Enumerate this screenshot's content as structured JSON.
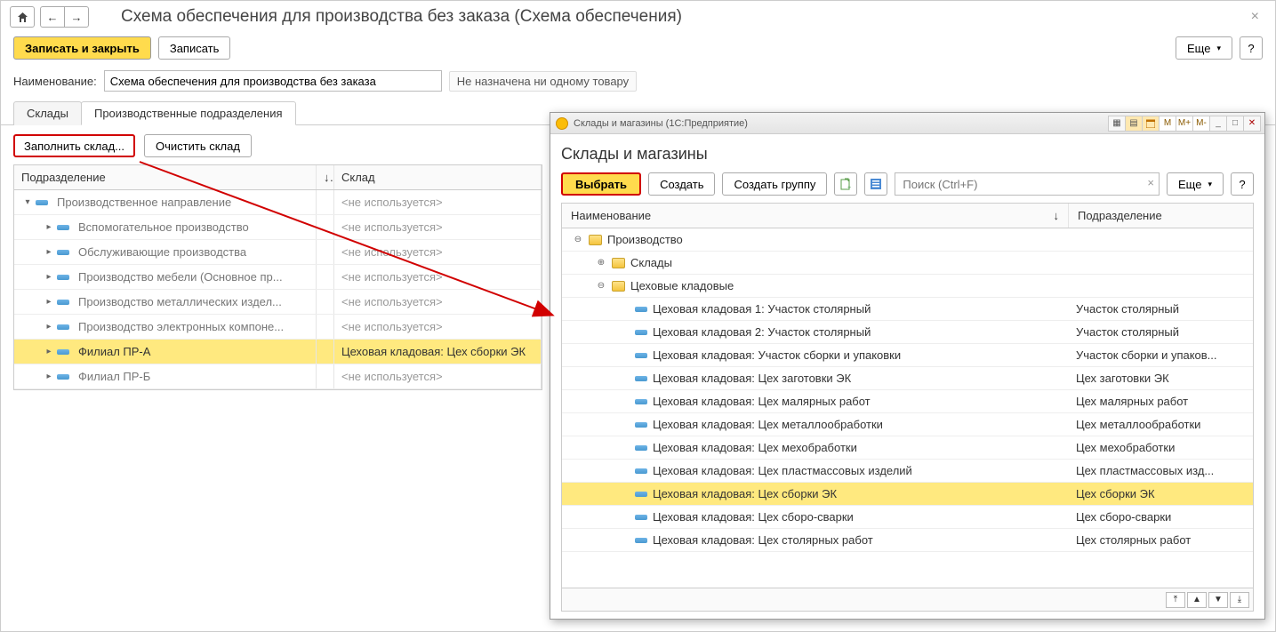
{
  "main": {
    "title": "Схема обеспечения для производства без заказа (Схема обеспечения)",
    "save_close": "Записать и закрыть",
    "save": "Записать",
    "more": "Еще",
    "help": "?",
    "name_label": "Наименование:",
    "name_value": "Схема обеспечения для производства без заказа",
    "unassigned_text": "Не назначена ни одному товару",
    "tabs": {
      "warehouses": "Склады",
      "prod_units": "Производственные подразделения"
    },
    "fill_warehouse": "Заполнить склад...",
    "clear_warehouse": "Очистить склад",
    "grid_head": {
      "dept": "Подразделение",
      "sort": "↓",
      "sklad": "Склад"
    },
    "rows": [
      {
        "indent": 0,
        "toggle": "▾",
        "label": "Производственное направление",
        "sklad": "<не используется>",
        "sel": false
      },
      {
        "indent": 1,
        "toggle": "▸",
        "label": "Вспомогательное производство",
        "sklad": "<не используется>",
        "sel": false
      },
      {
        "indent": 1,
        "toggle": "▸",
        "label": "Обслуживающие производства",
        "sklad": "<не используется>",
        "sel": false
      },
      {
        "indent": 1,
        "toggle": "▸",
        "label": "Производство мебели (Основное пр...",
        "sklad": "<не используется>",
        "sel": false
      },
      {
        "indent": 1,
        "toggle": "▸",
        "label": "Производство металлических издел...",
        "sklad": "<не используется>",
        "sel": false
      },
      {
        "indent": 1,
        "toggle": "▸",
        "label": "Производство электронных компоне...",
        "sklad": "<не используется>",
        "sel": false
      },
      {
        "indent": 1,
        "toggle": "▸",
        "label": "Филиал ПР-А",
        "sklad": "Цеховая кладовая: Цех сборки ЭК",
        "sel": true
      },
      {
        "indent": 1,
        "toggle": "▸",
        "label": "Филиал ПР-Б",
        "sklad": "<не используется>",
        "sel": false
      }
    ]
  },
  "popup": {
    "win_caption": "Склады и магазины  (1С:Предприятие)",
    "win_tools": {
      "m": "M",
      "mplus": "M+",
      "mminus": "M-"
    },
    "title": "Склады и магазины",
    "select": "Выбрать",
    "create": "Создать",
    "create_group": "Создать группу",
    "search_placeholder": "Поиск (Ctrl+F)",
    "more": "Еще",
    "help": "?",
    "head_name": "Наименование",
    "head_sort": "↓",
    "head_dept": "Подразделение",
    "rows": [
      {
        "type": "folder",
        "indent": 0,
        "toggle": "⊖",
        "label": "Производство",
        "dept": ""
      },
      {
        "type": "folder",
        "indent": 1,
        "toggle": "⊕",
        "label": "Склады",
        "dept": ""
      },
      {
        "type": "folder",
        "indent": 1,
        "toggle": "⊖",
        "label": "Цеховые кладовые",
        "dept": ""
      },
      {
        "type": "leaf",
        "indent": 2,
        "label": "Цеховая кладовая 1: Участок столярный",
        "dept": "Участок столярный"
      },
      {
        "type": "leaf",
        "indent": 2,
        "label": "Цеховая кладовая 2: Участок столярный",
        "dept": "Участок столярный"
      },
      {
        "type": "leaf",
        "indent": 2,
        "label": "Цеховая кладовая: Участок сборки и упаковки",
        "dept": "Участок сборки и упаков..."
      },
      {
        "type": "leaf",
        "indent": 2,
        "label": "Цеховая кладовая: Цех заготовки ЭК",
        "dept": "Цех заготовки ЭК"
      },
      {
        "type": "leaf",
        "indent": 2,
        "label": "Цеховая кладовая: Цех малярных работ",
        "dept": "Цех малярных работ"
      },
      {
        "type": "leaf",
        "indent": 2,
        "label": "Цеховая кладовая: Цех металлообработки",
        "dept": "Цех металлообработки"
      },
      {
        "type": "leaf",
        "indent": 2,
        "label": "Цеховая кладовая: Цех мехобработки",
        "dept": "Цех мехобработки"
      },
      {
        "type": "leaf",
        "indent": 2,
        "label": "Цеховая кладовая: Цех пластмассовых изделий",
        "dept": "Цех пластмассовых изд..."
      },
      {
        "type": "leaf",
        "indent": 2,
        "label": "Цеховая кладовая: Цех сборки ЭК",
        "dept": "Цех сборки ЭК",
        "sel": true
      },
      {
        "type": "leaf",
        "indent": 2,
        "label": "Цеховая кладовая: Цех сборо-сварки",
        "dept": "Цех сборо-сварки"
      },
      {
        "type": "leaf",
        "indent": 2,
        "label": "Цеховая кладовая: Цех столярных работ",
        "dept": "Цех столярных работ"
      }
    ]
  }
}
